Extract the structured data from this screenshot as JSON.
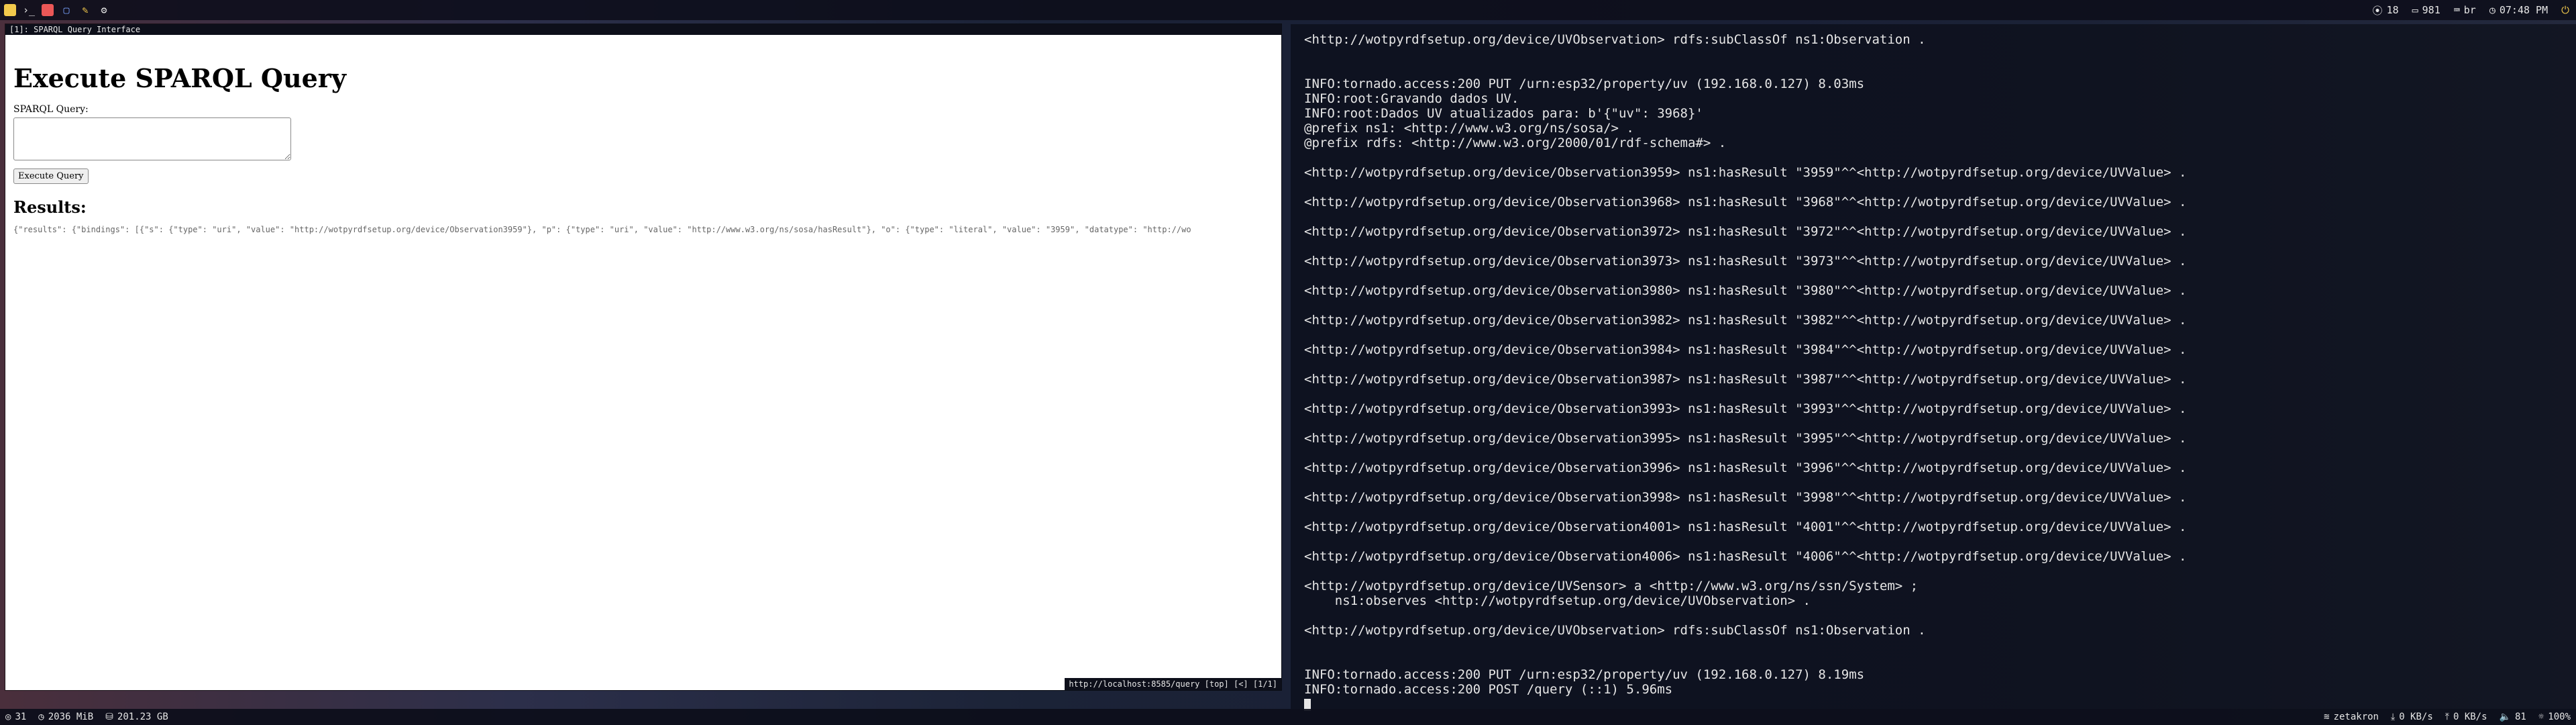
{
  "colors": {
    "topbar_bg": "#0c0e1a",
    "terminal_text": "#e6e6e6",
    "browser_bg": "#ffffff"
  },
  "top_bar": {
    "left_icons": [
      "app-icon",
      "terminal-icon",
      "circle-icon",
      "folder-icon",
      "edit-icon",
      "settings-icon"
    ],
    "cpu_temp": "18",
    "memory": "981",
    "keyboard_layout": "br",
    "time": "07:48 PM",
    "power_icon": "power-icon"
  },
  "browser": {
    "window_title": "[1]: SPARQL Query Interface",
    "heading": "Execute SPARQL Query",
    "query_label": "SPARQL Query:",
    "query_value": "",
    "execute_button": "Execute Query",
    "results_heading": "Results:",
    "results_text": "{\"results\": {\"bindings\": [{\"s\": {\"type\": \"uri\", \"value\": \"http://wotpyrdfsetup.org/device/Observation3959\"}, \"p\": {\"type\": \"uri\", \"value\": \"http://www.w3.org/ns/sosa/hasResult\"}, \"o\": {\"type\": \"literal\", \"value\": \"3959\", \"datatype\": \"http://wo",
    "status_line": "http://localhost:8585/query [top] [<] [1/1]"
  },
  "terminal": {
    "lines": [
      "<http://wotpyrdfsetup.org/device/UVObservation> rdfs:subClassOf ns1:Observation .",
      "",
      "",
      "INFO:tornado.access:200 PUT /urn:esp32/property/uv (192.168.0.127) 8.03ms",
      "INFO:root:Gravando dados UV.",
      "INFO:root:Dados UV atualizados para: b'{\"uv\": 3968}'",
      "@prefix ns1: <http://www.w3.org/ns/sosa/> .",
      "@prefix rdfs: <http://www.w3.org/2000/01/rdf-schema#> .",
      "",
      "<http://wotpyrdfsetup.org/device/Observation3959> ns1:hasResult \"3959\"^^<http://wotpyrdfsetup.org/device/UVValue> .",
      "",
      "<http://wotpyrdfsetup.org/device/Observation3968> ns1:hasResult \"3968\"^^<http://wotpyrdfsetup.org/device/UVValue> .",
      "",
      "<http://wotpyrdfsetup.org/device/Observation3972> ns1:hasResult \"3972\"^^<http://wotpyrdfsetup.org/device/UVValue> .",
      "",
      "<http://wotpyrdfsetup.org/device/Observation3973> ns1:hasResult \"3973\"^^<http://wotpyrdfsetup.org/device/UVValue> .",
      "",
      "<http://wotpyrdfsetup.org/device/Observation3980> ns1:hasResult \"3980\"^^<http://wotpyrdfsetup.org/device/UVValue> .",
      "",
      "<http://wotpyrdfsetup.org/device/Observation3982> ns1:hasResult \"3982\"^^<http://wotpyrdfsetup.org/device/UVValue> .",
      "",
      "<http://wotpyrdfsetup.org/device/Observation3984> ns1:hasResult \"3984\"^^<http://wotpyrdfsetup.org/device/UVValue> .",
      "",
      "<http://wotpyrdfsetup.org/device/Observation3987> ns1:hasResult \"3987\"^^<http://wotpyrdfsetup.org/device/UVValue> .",
      "",
      "<http://wotpyrdfsetup.org/device/Observation3993> ns1:hasResult \"3993\"^^<http://wotpyrdfsetup.org/device/UVValue> .",
      "",
      "<http://wotpyrdfsetup.org/device/Observation3995> ns1:hasResult \"3995\"^^<http://wotpyrdfsetup.org/device/UVValue> .",
      "",
      "<http://wotpyrdfsetup.org/device/Observation3996> ns1:hasResult \"3996\"^^<http://wotpyrdfsetup.org/device/UVValue> .",
      "",
      "<http://wotpyrdfsetup.org/device/Observation3998> ns1:hasResult \"3998\"^^<http://wotpyrdfsetup.org/device/UVValue> .",
      "",
      "<http://wotpyrdfsetup.org/device/Observation4001> ns1:hasResult \"4001\"^^<http://wotpyrdfsetup.org/device/UVValue> .",
      "",
      "<http://wotpyrdfsetup.org/device/Observation4006> ns1:hasResult \"4006\"^^<http://wotpyrdfsetup.org/device/UVValue> .",
      "",
      "<http://wotpyrdfsetup.org/device/UVSensor> a <http://www.w3.org/ns/ssn/System> ;",
      "    ns1:observes <http://wotpyrdfsetup.org/device/UVObservation> .",
      "",
      "<http://wotpyrdfsetup.org/device/UVObservation> rdfs:subClassOf ns1:Observation .",
      "",
      "",
      "INFO:tornado.access:200 PUT /urn:esp32/property/uv (192.168.0.127) 8.19ms",
      "INFO:tornado.access:200 POST /query (::1) 5.96ms"
    ]
  },
  "bottom_bar": {
    "cpu": "31",
    "mem": "2036 MiB",
    "disk": "201.23 GB",
    "network_name": "zetakron",
    "down": "0 KB/s",
    "up": "0 KB/s",
    "volume": "81",
    "brightness": "100%"
  }
}
